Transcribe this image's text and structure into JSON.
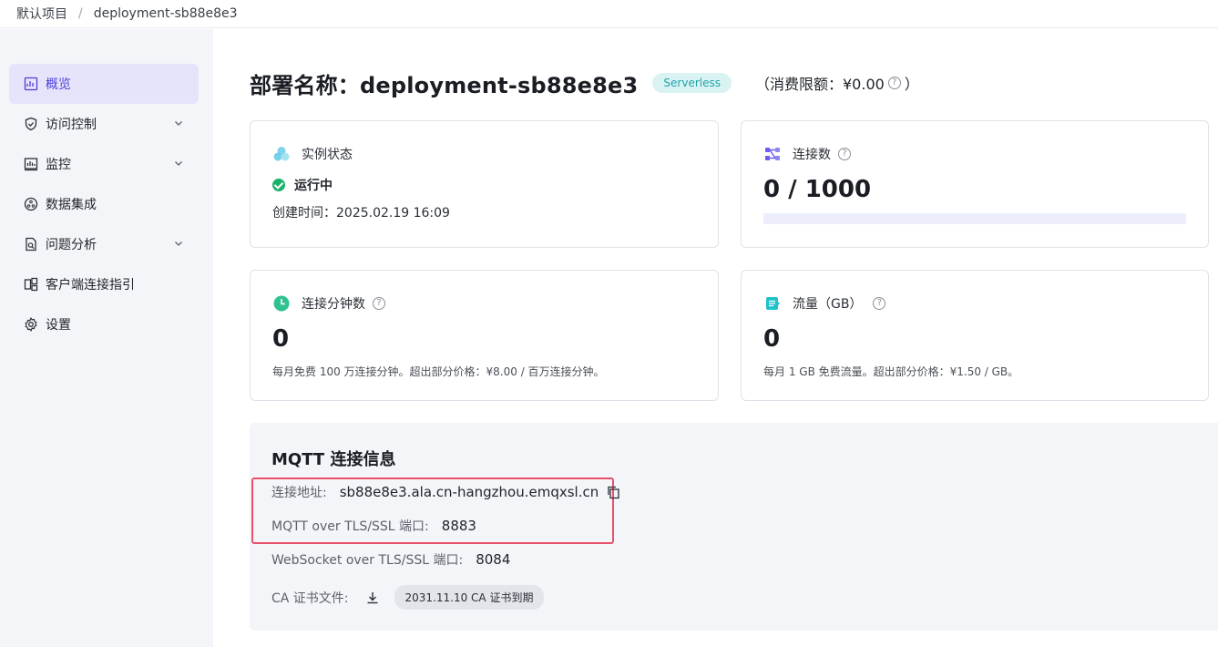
{
  "breadcrumb": {
    "project": "默认项目",
    "separator": "/",
    "deployment": "deployment-sb88e8e3"
  },
  "sidebar": {
    "items": [
      {
        "label": "概览",
        "icon": "dashboard-icon",
        "active": true,
        "expandable": false
      },
      {
        "label": "访问控制",
        "icon": "shield-icon",
        "active": false,
        "expandable": true
      },
      {
        "label": "监控",
        "icon": "chart-icon",
        "active": false,
        "expandable": true
      },
      {
        "label": "数据集成",
        "icon": "integration-icon",
        "active": false,
        "expandable": false
      },
      {
        "label": "问题分析",
        "icon": "analysis-icon",
        "active": false,
        "expandable": true
      },
      {
        "label": "客户端连接指引",
        "icon": "client-guide-icon",
        "active": false,
        "expandable": false
      },
      {
        "label": "设置",
        "icon": "gear-icon",
        "active": false,
        "expandable": false
      }
    ]
  },
  "header": {
    "title": "部署名称：deployment-sb88e8e3",
    "badge": "Serverless",
    "limit_prefix": "（消费限额：¥0.00",
    "limit_suffix": "）"
  },
  "cards": {
    "instance": {
      "title": "实例状态",
      "status": "运行中",
      "created": "创建时间：2025.02.19 16:09"
    },
    "connections": {
      "title": "连接数",
      "value": "0 / 1000",
      "usage_fraction": 0
    },
    "minutes": {
      "title": "连接分钟数",
      "value": "0",
      "note": "每月免费 100 万连接分钟。超出部分价格：¥8.00 / 百万连接分钟。"
    },
    "traffic": {
      "title": "流量（GB）",
      "value": "0",
      "note": "每月 1 GB 免费流量。超出部分价格：¥1.50 / GB。"
    }
  },
  "mqtt": {
    "title": "MQTT 连接信息",
    "address_label": "连接地址:",
    "address": "sb88e8e3.ala.cn-hangzhou.emqxsl.cn",
    "tls_label": "MQTT over TLS/SSL 端口:",
    "tls_port": "8883",
    "ws_label": "WebSocket over TLS/SSL 端口:",
    "ws_port": "8084",
    "ca_label": "CA 证书文件:",
    "ca_expiry": "2031.11.10 CA 证书到期"
  },
  "colors": {
    "accent": "#4b3fd6",
    "highlight": "#e8506c",
    "badge_bg": "#d9f3f3",
    "success": "#19b26b"
  }
}
